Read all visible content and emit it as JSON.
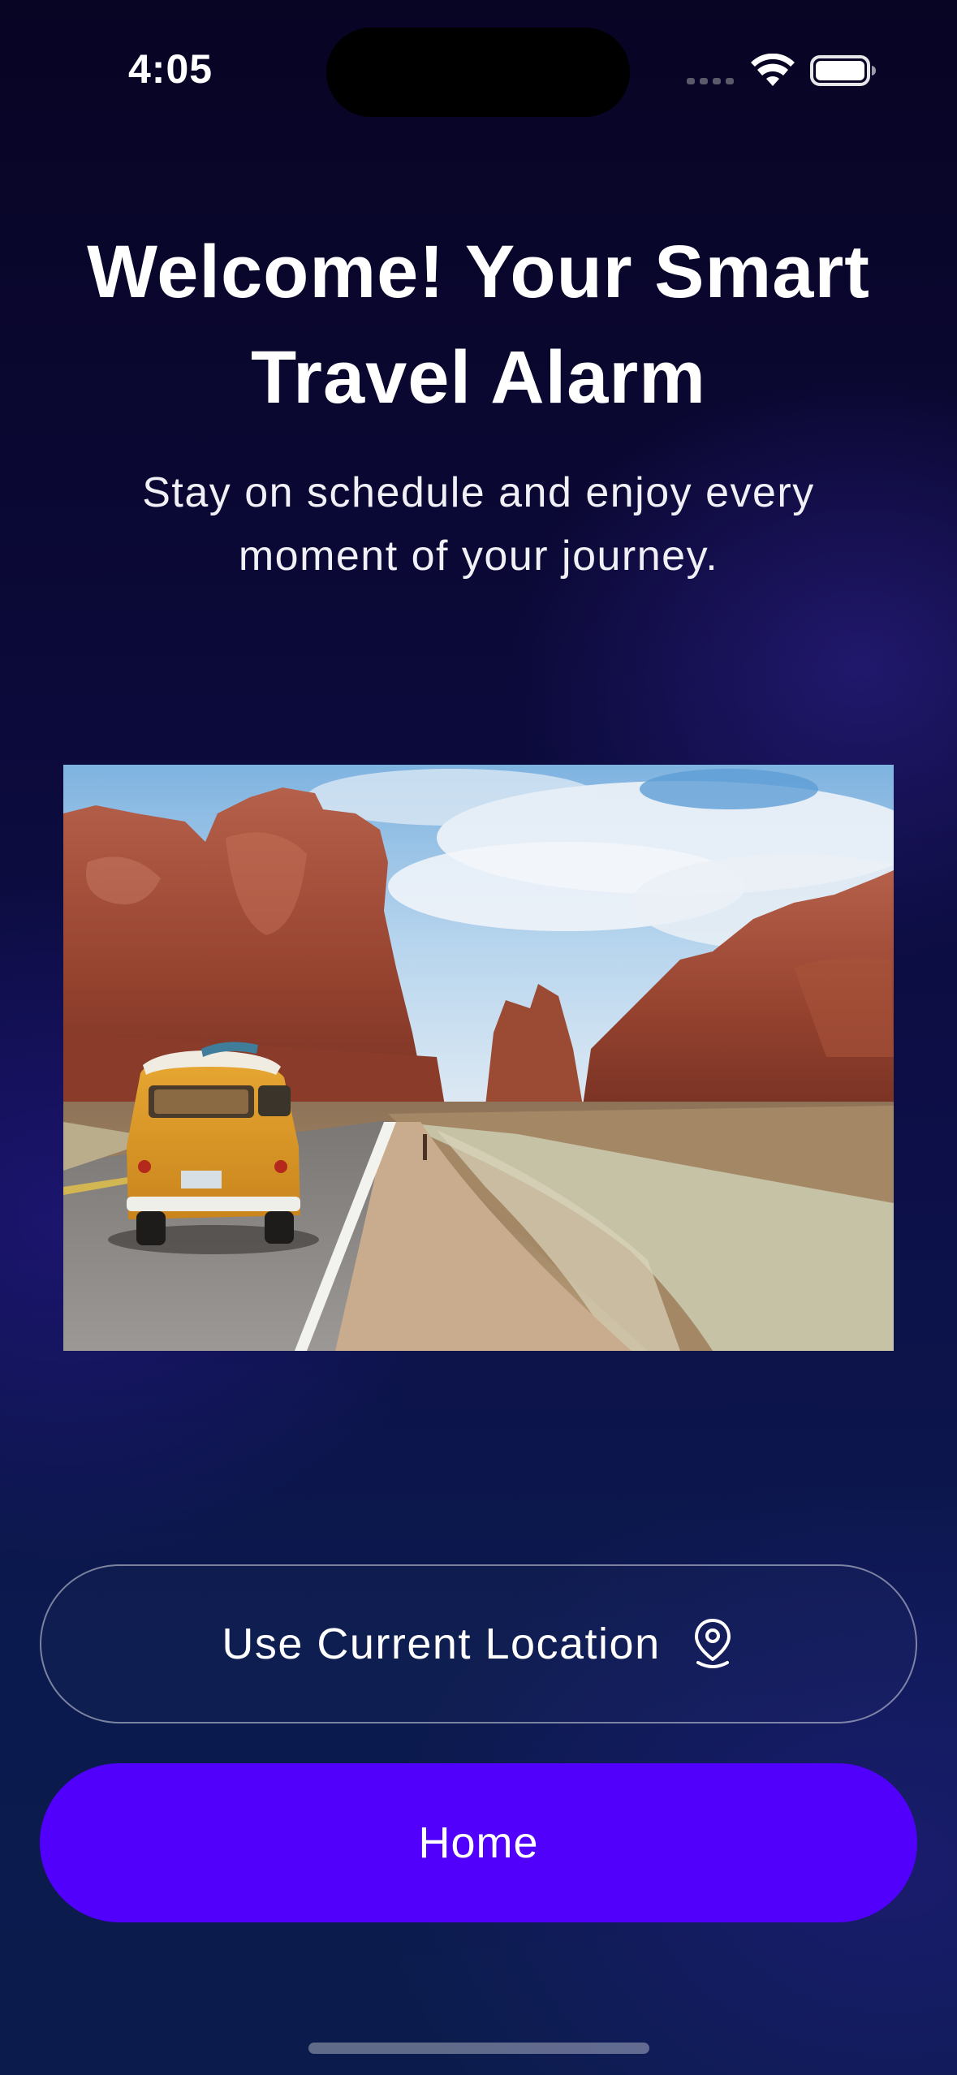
{
  "status_bar": {
    "time": "4:05"
  },
  "header": {
    "title": "Welcome! Your Smart Travel Alarm",
    "subtitle": "Stay on schedule and enjoy every moment of your journey."
  },
  "hero": {
    "image_subject": "yellow-van-desert-road"
  },
  "actions": {
    "location_label": "Use Current Location",
    "location_icon": "location-pin-icon",
    "home_label": "Home"
  },
  "colors": {
    "primary": "#5100fb",
    "background_top": "#080424",
    "background_bottom": "#0b1c4c",
    "outline": "#8a8aa8"
  }
}
